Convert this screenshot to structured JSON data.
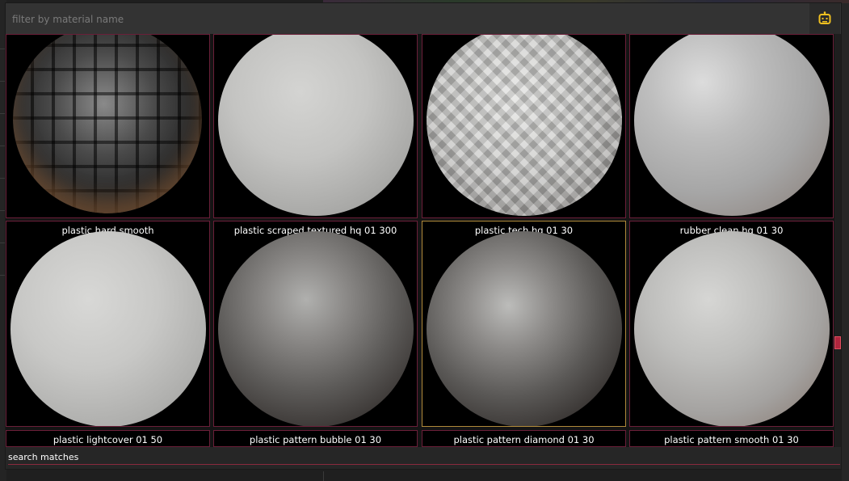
{
  "search": {
    "placeholder": "filter by material name",
    "value": ""
  },
  "toolbar": {
    "assistant_icon": "robot-icon",
    "accent": "#f0c020"
  },
  "materials": [
    {
      "label": "",
      "sphere": "dark-tiled"
    },
    {
      "label": "",
      "sphere": "white-matte"
    },
    {
      "label": "",
      "sphere": "white-diamond-pattern"
    },
    {
      "label": "",
      "sphere": "light-grey-satin"
    },
    {
      "label": "plastic hard smooth",
      "sphere": "white-matte"
    },
    {
      "label": "plastic scraped textured hq 01 300",
      "sphere": "metal-worn"
    },
    {
      "label": "plastic tech hq 01 30",
      "sphere": "metal-worn-dark",
      "selected": true
    },
    {
      "label": "rubber clean hq 01 30",
      "sphere": "light-grey-satin"
    },
    {
      "label": "plastic lightcover 01 50",
      "sphere": "white-matte"
    },
    {
      "label": "plastic pattern bubble 01 30",
      "sphere": "metal-worn"
    },
    {
      "label": "plastic pattern diamond 01 30",
      "sphere": "metal-worn"
    },
    {
      "label": "plastic pattern smooth 01 30",
      "sphere": "light-grey-satin"
    }
  ],
  "status": {
    "text": "search matches"
  },
  "colors": {
    "tile_border": "#6b1f39",
    "selected_border": "#b08a3a",
    "scroll_thumb": "#b0263e"
  }
}
